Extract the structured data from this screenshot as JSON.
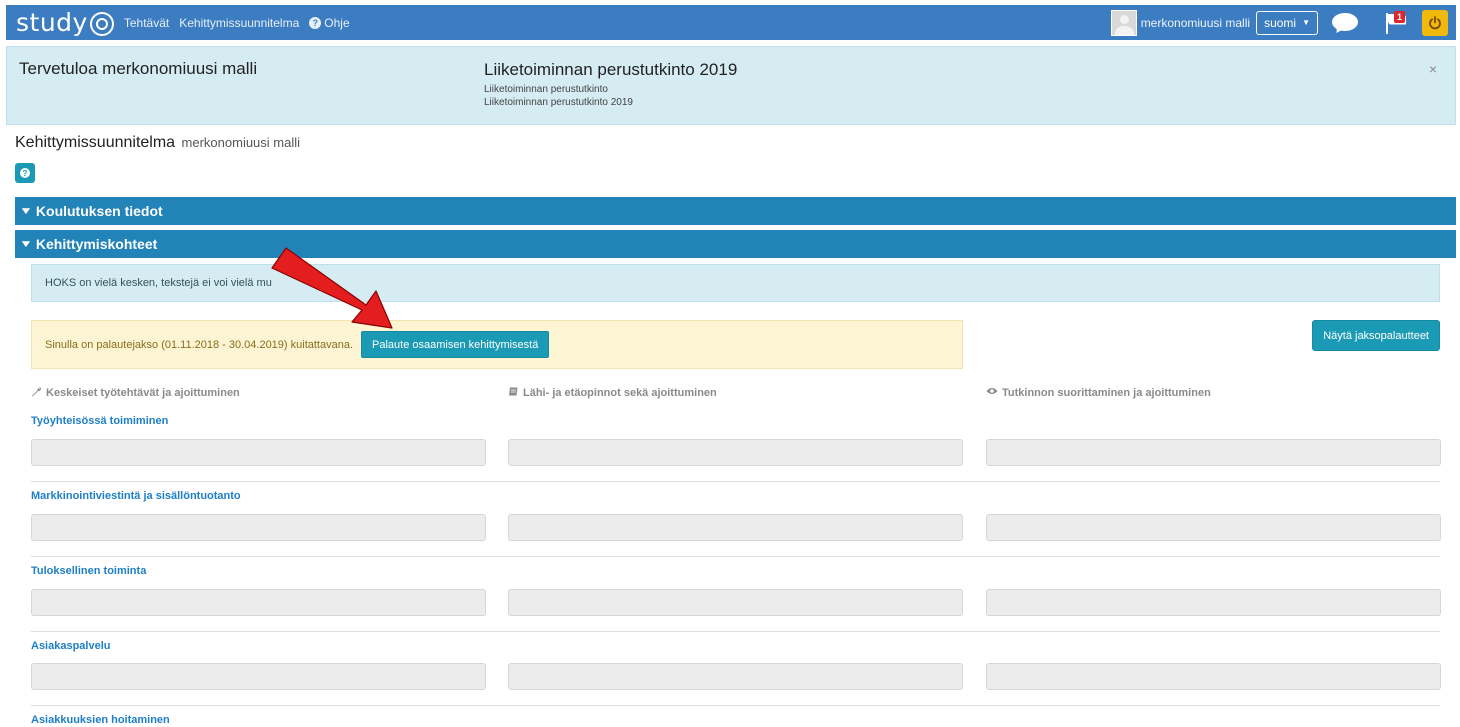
{
  "navbar": {
    "logo_text": "study",
    "links": [
      "Tehtävät",
      "Kehittymissuunnitelma",
      "Ohje"
    ],
    "user_name": "merkonomiuusi malli",
    "language": "suomi",
    "notification_count": "1",
    "colors": {
      "navbar_bg": "#3b7dc0",
      "power_button": "#f0b90c",
      "badge": "#d9292d"
    }
  },
  "welcome": {
    "title": "Tervetuloa merkonomiuusi malli",
    "degree_title": "Liiketoiminnan perustutkinto 2019",
    "degree_line1": "Liiketoiminnan perustutkinto",
    "degree_line2": "Liiketoiminnan perustutkinto 2019",
    "close_symbol": "×"
  },
  "page": {
    "title": "Kehittymissuunnitelma",
    "subtitle": "merkonomiuusi malli"
  },
  "accordion": {
    "section1": "Koulutuksen tiedot",
    "section2": "Kehittymiskohteet"
  },
  "content": {
    "hoks_note": "HOKS on vielä kesken, tekstejä ei voi vielä mu",
    "feedback_text": "Sinulla on palautejakso (01.11.2018 - 30.04.2019) kuitattavana.",
    "feedback_button": "Palaute osaamisen kehittymisestä",
    "show_feedback_button": "Näytä jaksopalautteet",
    "columns": [
      {
        "icon": "wrench-icon",
        "label": "Keskeiset työtehtävät ja ajoittuminen"
      },
      {
        "icon": "book-icon",
        "label": "Lähi- ja etäopinnot sekä ajoittuminen"
      },
      {
        "icon": "eye-icon",
        "label": "Tutkinnon suorittaminen ja ajoittuminen"
      }
    ],
    "topics": [
      "Työyhteisössä toimiminen",
      "Markkinointiviestintä ja sisällöntuotanto",
      "Tuloksellinen toiminta",
      "Asiakaspalvelu",
      "Asiakkuuksien hoitaminen"
    ]
  },
  "colors": {
    "accordion": "#2283b8",
    "button": "#1a9ab5",
    "info_bg": "#d5ecf3",
    "warning_bg": "#fcf4d2",
    "link": "#1e7fc8",
    "annotation_arrow": "#e41e1e"
  }
}
